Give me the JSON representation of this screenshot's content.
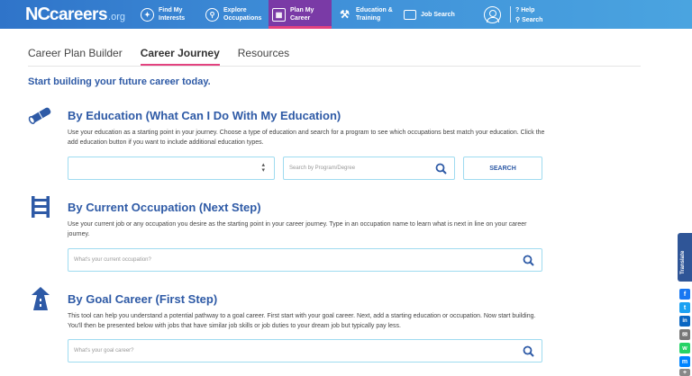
{
  "header": {
    "logo": {
      "nc": "NC",
      "careers": "careers",
      "org": ".org",
      "tagline": ""
    },
    "nav": [
      {
        "label_line1": "Find My",
        "label_line2": "Interests",
        "icon": "compass-icon"
      },
      {
        "label_line1": "Explore",
        "label_line2": "Occupations",
        "icon": "magnifier-person-icon"
      },
      {
        "label_line1": "Plan My",
        "label_line2": "Career",
        "icon": "map-icon"
      },
      {
        "label_line1": "Education &",
        "label_line2": "Training",
        "icon": "tools-icon"
      },
      {
        "label_line1": "Job Search",
        "label_line2": "",
        "icon": "briefcase-icon"
      }
    ],
    "help": "Help",
    "search": "Search"
  },
  "tabs": [
    {
      "label": "Career Plan Builder",
      "active": false
    },
    {
      "label": "Career Journey",
      "active": true
    },
    {
      "label": "Resources",
      "active": false
    }
  ],
  "intro": "Start building your future career today.",
  "education": {
    "title": "By Education (What Can I Do With My Education)",
    "description": "Use your education as a starting point in your journey. Choose a type of education and search for a program to see which occupations best match your education. Click the add education button if you want to include additional education types.",
    "select_value": "",
    "search_placeholder": "Search by Program/Degree",
    "button": "SEARCH"
  },
  "occupation": {
    "title": "By Current Occupation (Next Step)",
    "description": "Use your current job or any occupation you desire as the starting point in your career journey. Type in an occupation name to learn what is next in line on your career journey.",
    "placeholder": "What's your current occupation?"
  },
  "goal": {
    "title": "By Goal Career (First Step)",
    "description": "This tool can help you understand a potential pathway to a goal career. First start with your goal career. Next, add a starting education or occupation. Now start building. You'll then be presented below with jobs that have similar job skills or job duties to your dream job but typically pay less.",
    "placeholder": "What's your goal career?"
  },
  "sidebar": {
    "translate": "Translate",
    "share": [
      {
        "icon": "facebook-icon",
        "color": "#1877f2",
        "glyph": "f"
      },
      {
        "icon": "twitter-icon",
        "color": "#1da1f2",
        "glyph": "t"
      },
      {
        "icon": "linkedin-icon",
        "color": "#0a66c2",
        "glyph": "in"
      },
      {
        "icon": "email-icon",
        "color": "#777777",
        "glyph": "✉"
      },
      {
        "icon": "whatsapp-icon",
        "color": "#25d366",
        "glyph": "w"
      },
      {
        "icon": "messenger-icon",
        "color": "#0084ff",
        "glyph": "m"
      },
      {
        "icon": "more-icon",
        "color": "#888888",
        "glyph": "+"
      }
    ]
  },
  "colors": {
    "primary": "#2e5aa6",
    "accent": "#e3427f",
    "border": "#9fdbf0",
    "topbar": "#3f8fd8"
  }
}
